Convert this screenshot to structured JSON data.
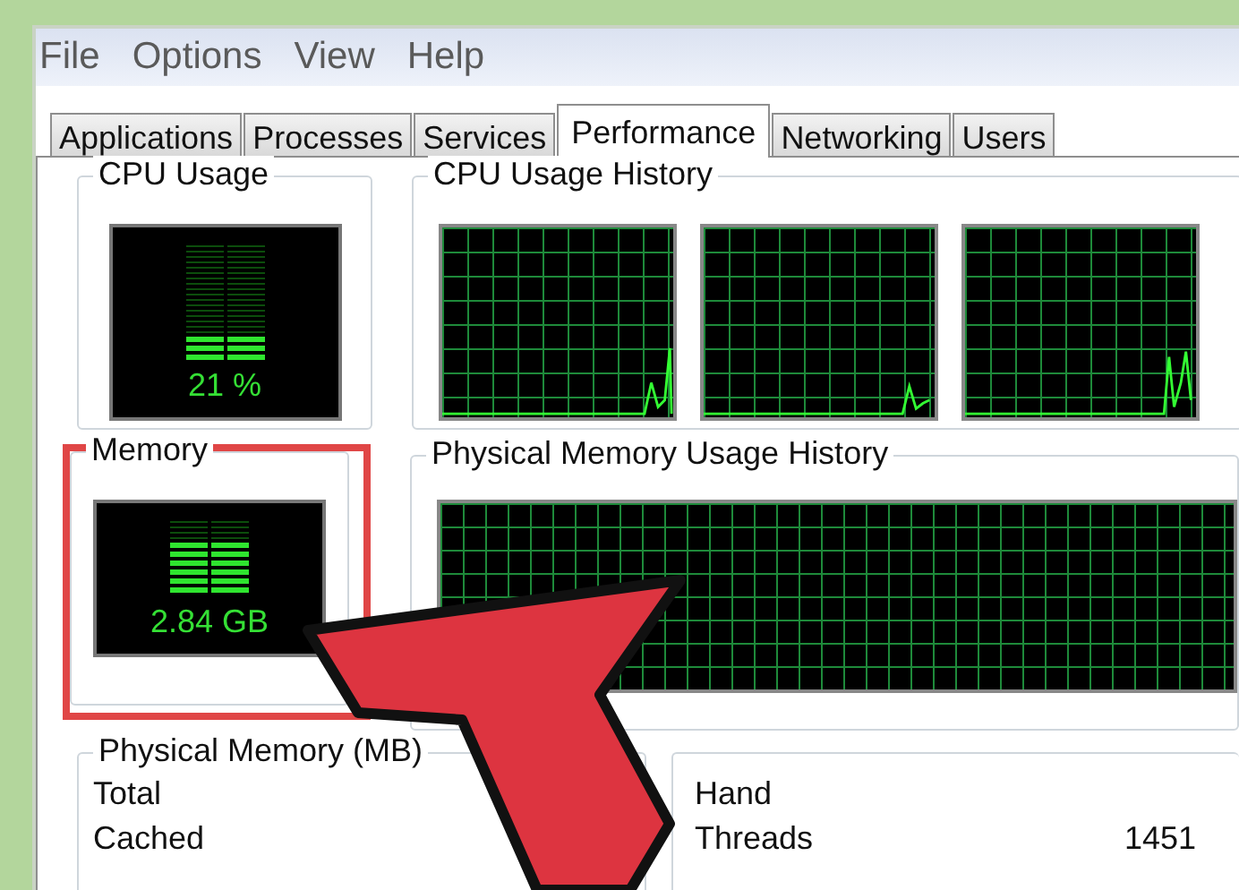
{
  "menu": [
    "File",
    "Options",
    "View",
    "Help"
  ],
  "tabs": [
    {
      "label": "Applications",
      "selected": false
    },
    {
      "label": "Processes",
      "selected": false
    },
    {
      "label": "Services",
      "selected": false
    },
    {
      "label": "Performance",
      "selected": true
    },
    {
      "label": "Networking",
      "selected": false
    },
    {
      "label": "Users",
      "selected": false
    }
  ],
  "cpu_usage": {
    "title": "CPU Usage",
    "level": 0.21,
    "reading": "21 %"
  },
  "cpu_history": {
    "title": "CPU Usage History"
  },
  "memory": {
    "title": "Memory",
    "level": 0.72,
    "reading": "2.84 GB",
    "highlighted": true
  },
  "memory_history": {
    "title": "Physical Memory Usage History"
  },
  "physical_memory": {
    "title": "Physical Memory (MB)",
    "rows": [
      {
        "label": "Total"
      },
      {
        "label": "Cached"
      }
    ]
  },
  "system": {
    "rows": [
      {
        "label": "Hand"
      },
      {
        "label": "Threads",
        "value": "1451"
      }
    ]
  }
}
